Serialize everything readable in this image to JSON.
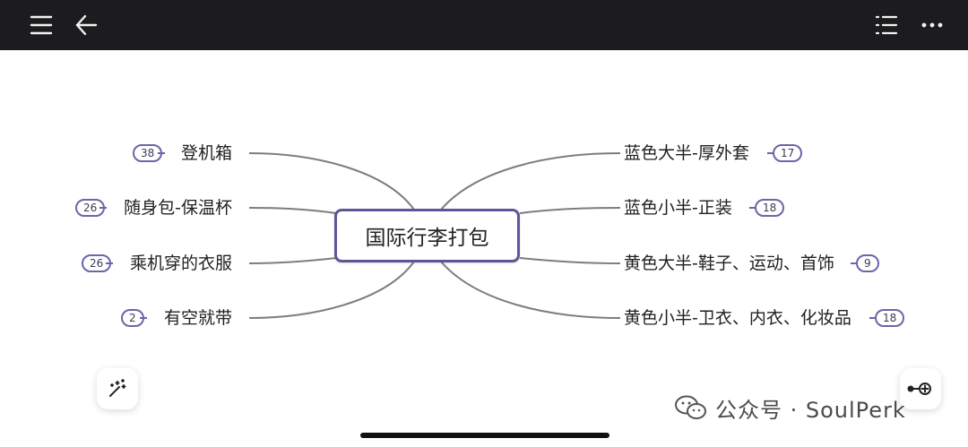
{
  "topbar": {
    "menu_icon": "hamburger-menu-icon",
    "back_icon": "back-arrow-icon",
    "outline_icon": "outline-list-icon",
    "more_icon": "more-horizontal-icon"
  },
  "mindmap": {
    "root": "国际行李打包",
    "left_branches": [
      {
        "label": "登机箱",
        "count": "38"
      },
      {
        "label": "随身包-保温杯",
        "count": "26"
      },
      {
        "label": "乘机穿的衣服",
        "count": "26"
      },
      {
        "label": "有空就带",
        "count": "2"
      }
    ],
    "right_branches": [
      {
        "label": "蓝色大半-厚外套",
        "count": "17"
      },
      {
        "label": "蓝色小半-正装",
        "count": "18"
      },
      {
        "label": "黄色大半-鞋子、运动、首饰",
        "count": "9"
      },
      {
        "label": "黄色小半-卫衣、内衣、化妆品",
        "count": "18"
      }
    ],
    "line_color": "#7d7d7d",
    "accent_color": "#5b5799"
  },
  "tools": {
    "magic_icon": "magic-wand-icon",
    "locate_icon": "locate-node-icon"
  },
  "watermark": {
    "text": "公众号 · SoulPerk",
    "logo_icon": "wechat-logo-icon"
  }
}
